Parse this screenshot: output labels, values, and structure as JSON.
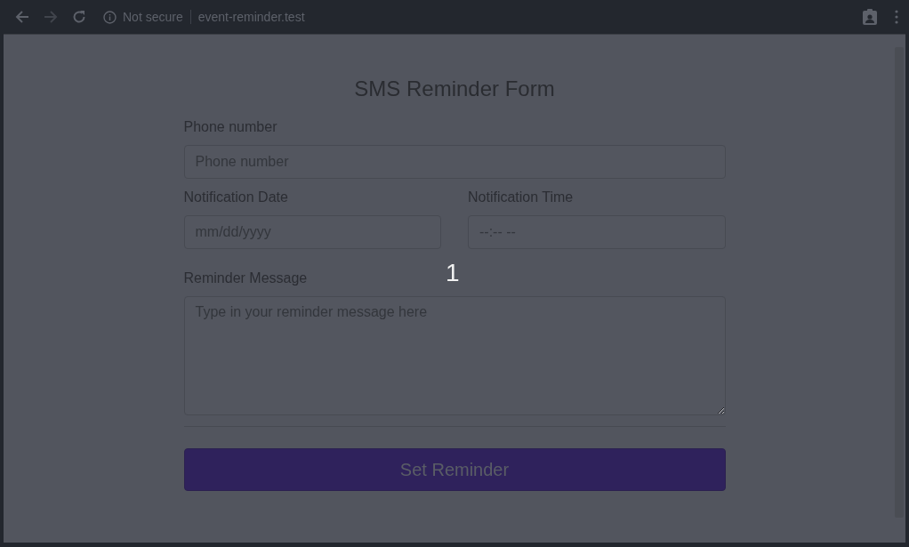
{
  "browser": {
    "security": "Not secure",
    "url": "event-reminder.test"
  },
  "form": {
    "title": "SMS Reminder Form",
    "fields": [
      {
        "kind": "text",
        "label": "Phone number",
        "placeholder": "Phone number"
      },
      {
        "kind": "half",
        "label": "Notification Date",
        "placeholder": "mm/dd/yyyy"
      },
      {
        "kind": "half",
        "label": "Notification Time",
        "placeholder": "--:-- --"
      },
      {
        "kind": "textarea",
        "label": "Reminder Message",
        "placeholder": "Type in your reminder message here"
      }
    ],
    "submit": "Set Reminder"
  },
  "overlay": {
    "text": "1"
  }
}
